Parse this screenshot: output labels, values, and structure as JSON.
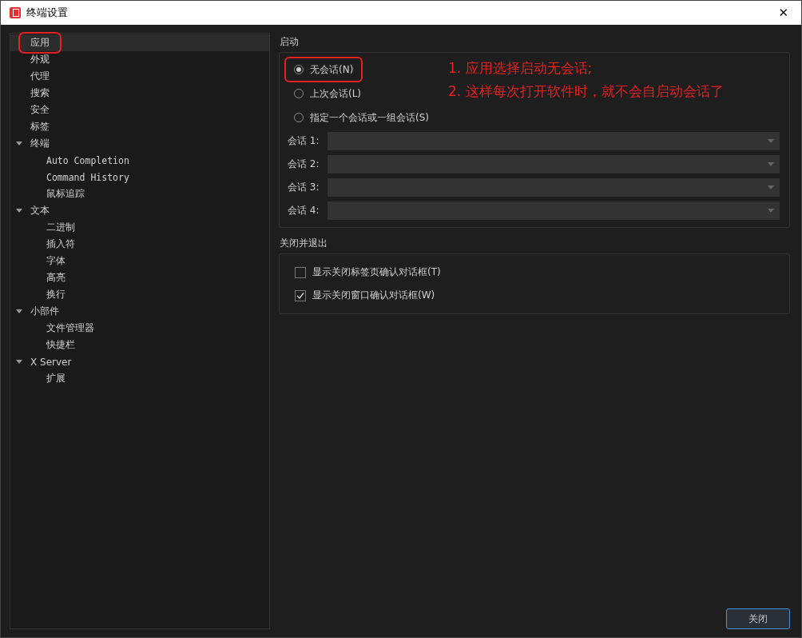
{
  "window": {
    "title": "终端设置",
    "close": "✕"
  },
  "sidebar": {
    "items": [
      {
        "label": "应用",
        "selected": true,
        "highlighted": true
      },
      {
        "label": "外观",
        "selected": false
      },
      {
        "label": "代理",
        "selected": false
      },
      {
        "label": "搜索",
        "selected": false
      },
      {
        "label": "安全",
        "selected": false
      },
      {
        "label": "标签",
        "selected": false
      },
      {
        "label": "终端",
        "selected": false,
        "expanded": true,
        "children": [
          {
            "label": "Auto Completion",
            "selected": false
          },
          {
            "label": "Command History",
            "selected": false
          },
          {
            "label": "鼠标追踪",
            "selected": false
          }
        ]
      },
      {
        "label": "文本",
        "selected": false,
        "expanded": true,
        "children": [
          {
            "label": "二进制",
            "selected": false
          },
          {
            "label": "插入符",
            "selected": false
          },
          {
            "label": "字体",
            "selected": false
          },
          {
            "label": "高亮",
            "selected": false
          },
          {
            "label": "换行",
            "selected": false
          }
        ]
      },
      {
        "label": "小部件",
        "selected": false,
        "expanded": true,
        "children": [
          {
            "label": "文件管理器",
            "selected": false
          },
          {
            "label": "快捷栏",
            "selected": false
          }
        ]
      },
      {
        "label": "X Server",
        "selected": false,
        "expanded": true,
        "children": [
          {
            "label": "扩展",
            "selected": false
          }
        ]
      }
    ]
  },
  "startup": {
    "title": "启动",
    "options": [
      {
        "label": "无会话(N)",
        "selected": true,
        "highlighted": true
      },
      {
        "label": "上次会话(L)",
        "selected": false
      },
      {
        "label": "指定一个会话或一组会话(S)",
        "selected": false
      }
    ],
    "sessions": [
      {
        "label": "会话 1:"
      },
      {
        "label": "会话 2:"
      },
      {
        "label": "会话 3:"
      },
      {
        "label": "会话 4:"
      }
    ]
  },
  "annotations": [
    "1. 应用选择启动无会话;",
    "2. 这样每次打开软件时，就不会自启动会话了"
  ],
  "close_exit": {
    "title": "关闭并退出",
    "checkboxes": [
      {
        "label": "显示关闭标签页确认对话框(T)",
        "checked": false
      },
      {
        "label": "显示关闭窗口确认对话框(W)",
        "checked": true
      }
    ]
  },
  "buttons": [
    "关闭"
  ]
}
